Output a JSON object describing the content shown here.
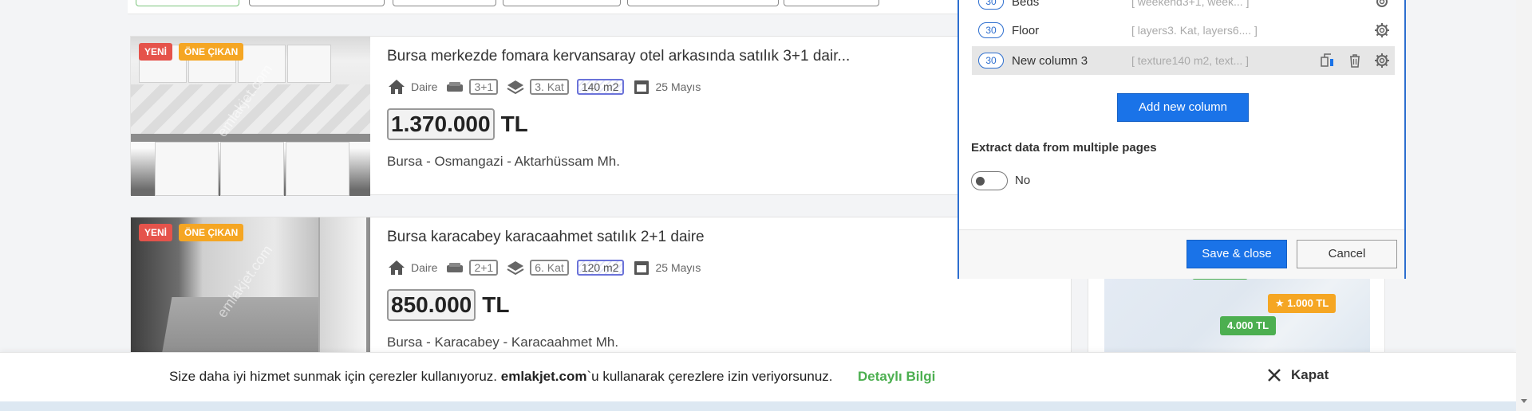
{
  "listings": [
    {
      "badge_new": "YENİ",
      "badge_featured": "ÖNE ÇIKAN",
      "title": "Bursa merkezde fomara kervansaray otel arkasında satılık 3+1 dair...",
      "type": "Daire",
      "rooms": "3+1",
      "floor": "3. Kat",
      "area": "140 m2",
      "date": "25 Mayıs",
      "price": "1.370.000",
      "currency": "TL",
      "location": "Bursa - Osmangazi - Aktarhüssam Mh.",
      "watermark": "emlakjet.com"
    },
    {
      "badge_new": "YENİ",
      "badge_featured": "ÖNE ÇIKAN",
      "title": "Bursa karacabey karacaahmet satılık 2+1 daire",
      "type": "Daire",
      "rooms": "2+1",
      "floor": "6. Kat",
      "area": "120 m2",
      "date": "25 Mayıs",
      "price": "850.000",
      "currency": "TL",
      "location": "Bursa - Karacabey - Karacaahmet Mh.",
      "watermark": "emlakjet.com"
    }
  ],
  "map": {
    "tags": [
      {
        "label": "1.000 TL",
        "color": "#f5a623",
        "icon": "star-icon"
      },
      {
        "label": "4.000 TL",
        "color": "#4caf50"
      }
    ]
  },
  "dialog": {
    "rows": [
      {
        "num": "30",
        "name": "Beds",
        "preview": "[ weekend3+1, week... ]"
      },
      {
        "num": "30",
        "name": "Floor",
        "preview": "[ layers3. Kat, layers6.... ]"
      },
      {
        "num": "30",
        "name": "New column 3",
        "preview": "[ texture140 m2, text... ]"
      }
    ],
    "add_column_label": "Add new column",
    "multi_page_title": "Extract data from multiple pages",
    "toggle_value": "No",
    "save_label": "Save & close",
    "cancel_label": "Cancel"
  },
  "cookie": {
    "text_before": "Size daha iyi hizmet sunmak için çerezler kullanıyoruz.",
    "brand": "emlakjet.com",
    "text_after": "`u kullanarak çerezlere izin veriyorsunuz.",
    "link_label": "Detaylı Bilgi",
    "close_label": "Kapat"
  },
  "colors": {
    "primary_blue": "#1a73e8",
    "badge_red": "#e5534b",
    "badge_orange": "#f5a623",
    "link_green": "#4caf50"
  }
}
